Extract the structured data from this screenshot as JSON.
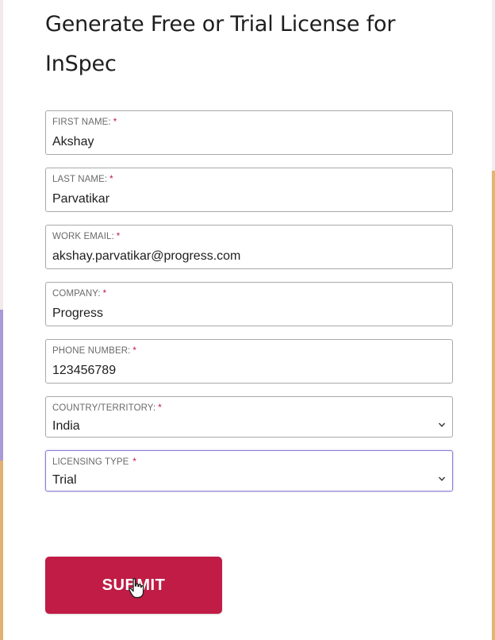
{
  "form": {
    "title": "Generate Free or Trial License for InSpec",
    "required_marker": "*",
    "fields": [
      {
        "label": "FIRST NAME:",
        "value": "Akshay"
      },
      {
        "label": "LAST NAME:",
        "value": "Parvatikar"
      },
      {
        "label": "WORK EMAIL:",
        "value": "akshay.parvatikar@progress.com"
      },
      {
        "label": "COMPANY:",
        "value": "Progress"
      },
      {
        "label": "PHONE NUMBER:",
        "value": "123456789"
      }
    ],
    "selects": [
      {
        "label": "COUNTRY/TERRITORY:",
        "value": "India",
        "icon": "chevron-down-icon"
      },
      {
        "label": "LICENSING TYPE",
        "value": "Trial",
        "icon": "chevron-down-icon"
      }
    ],
    "submit_label": "SUBMIT"
  },
  "colors": {
    "accent": "#c01c45",
    "required": "#c0183f",
    "focus_border": "#8c7ed3",
    "field_border": "#a9a9a9",
    "text": "#1e1e1e",
    "label_text": "#6a6a6a"
  },
  "cursor": {
    "icon": "hand-pointer-icon"
  }
}
